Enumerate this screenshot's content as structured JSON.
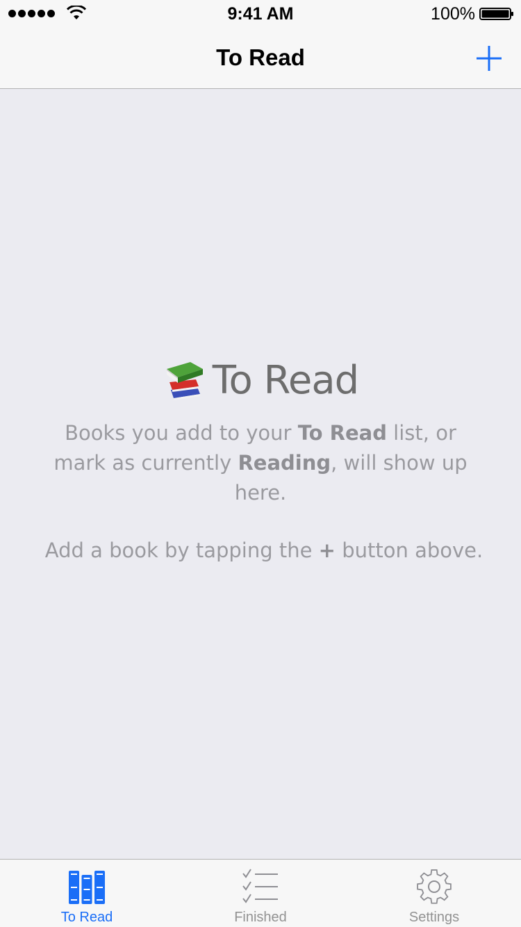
{
  "status_bar": {
    "time": "9:41 AM",
    "battery": "100%"
  },
  "nav": {
    "title": "To Read",
    "add_icon": "plus-icon"
  },
  "empty_state": {
    "icon": "books-icon",
    "title": "To Read",
    "text_1": "Books you add to your ",
    "text_2": "To Read",
    "text_3": " list, or mark as currently ",
    "text_4": "Reading",
    "text_5": ", will show up here.",
    "hint_1": "Add a book by tapping the ",
    "hint_2": "+",
    "hint_3": " button above."
  },
  "tabs": [
    {
      "label": "To Read",
      "icon": "bookshelf-icon",
      "active": true
    },
    {
      "label": "Finished",
      "icon": "checklist-icon",
      "active": false
    },
    {
      "label": "Settings",
      "icon": "gear-icon",
      "active": false
    }
  ],
  "colors": {
    "accent": "#1a6ef7",
    "background": "#ebebf1",
    "bar_background": "#f7f7f7",
    "inactive_tab": "#929292"
  }
}
